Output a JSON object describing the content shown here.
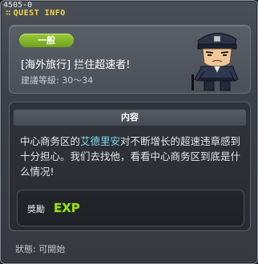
{
  "quest": {
    "id": "4505-0",
    "window_title": "QUEST INFO",
    "tag": "一般",
    "name": "[海外旅行] 拦住超速者!",
    "level": "建議等級: 30〜34"
  },
  "content": {
    "header": "内容",
    "desc_before": "中心商务区的",
    "desc_npc": "艾德里安",
    "desc_after": "对不断增长的超速违章感到十分担心。我们去找他，看看中心商务区到底是什么情况!"
  },
  "reward": {
    "label": "獎勵",
    "icon": "exp-icon",
    "icon_text": "EXP"
  },
  "status": {
    "text": "狀態: 可開始"
  },
  "colors": {
    "title": "#f2d64a",
    "tag": "#8cbf32",
    "npc": "#7fd9ee",
    "exp": "#9be01a"
  }
}
